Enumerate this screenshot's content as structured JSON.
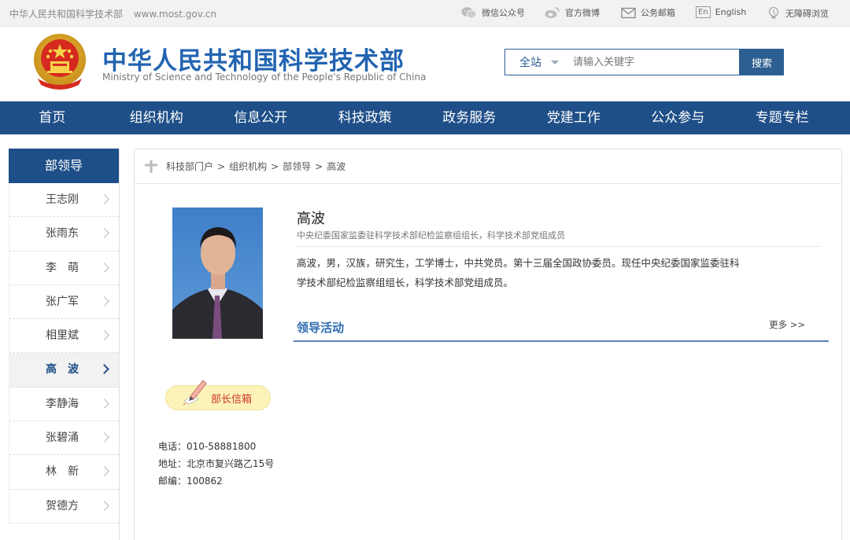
{
  "topbar": {
    "site_name": "中华人民共和国科学技术部",
    "site_url": "www.most.gov.cn",
    "links": [
      {
        "label": "微信公众号",
        "icon": "wechat-icon"
      },
      {
        "label": "官方微博",
        "icon": "weibo-icon"
      },
      {
        "label": "公务邮箱",
        "icon": "mail-icon"
      },
      {
        "label": "English",
        "icon": "english-icon",
        "icon_text": "En"
      },
      {
        "label": "无障碍浏览",
        "icon": "accessibility-icon"
      }
    ]
  },
  "header": {
    "title_cn": "中华人民共和国科学技术部",
    "title_en": "Ministry of Science and Technology of the People's Republic of China",
    "search": {
      "scope": "全站",
      "placeholder": "请输入关键字",
      "button": "搜索"
    }
  },
  "nav": {
    "items": [
      "首页",
      "组织机构",
      "信息公开",
      "科技政策",
      "政务服务",
      "党建工作",
      "公众参与",
      "专题专栏"
    ]
  },
  "sidebar": {
    "heading": "部领导",
    "items": [
      "王志刚",
      "张雨东",
      "李　萌",
      "张广军",
      "相里斌",
      "高　波",
      "李静海",
      "张碧涌",
      "林　新",
      "贺德方"
    ],
    "active_index": 5
  },
  "breadcrumb": [
    "科技部门户",
    "组织机构",
    "部领导",
    "高波"
  ],
  "breadcrumb_sep": ">",
  "profile": {
    "name": "高波",
    "title": "中央纪委国家监委驻科学技术部纪检监察组组长，科学技术部党组成员",
    "bio": "高波，男，汉族，研究生，工学博士，中共党员。第十三届全国政协委员。现任中央纪委国家监委驻科学技术部纪检监察组组长，科学技术部党组成员。"
  },
  "activities": {
    "heading": "领导活动",
    "more": "更多 >>"
  },
  "mailbox": {
    "label": "部长信箱"
  },
  "contact": {
    "phone": "电话：010-58881800",
    "address": "地址：北京市复兴路乙15号",
    "postcode": "邮编：100862"
  },
  "colors": {
    "nav_bg": "#1f4f88",
    "title_blue": "#2264b0",
    "mailbox_red": "#d0342c"
  }
}
